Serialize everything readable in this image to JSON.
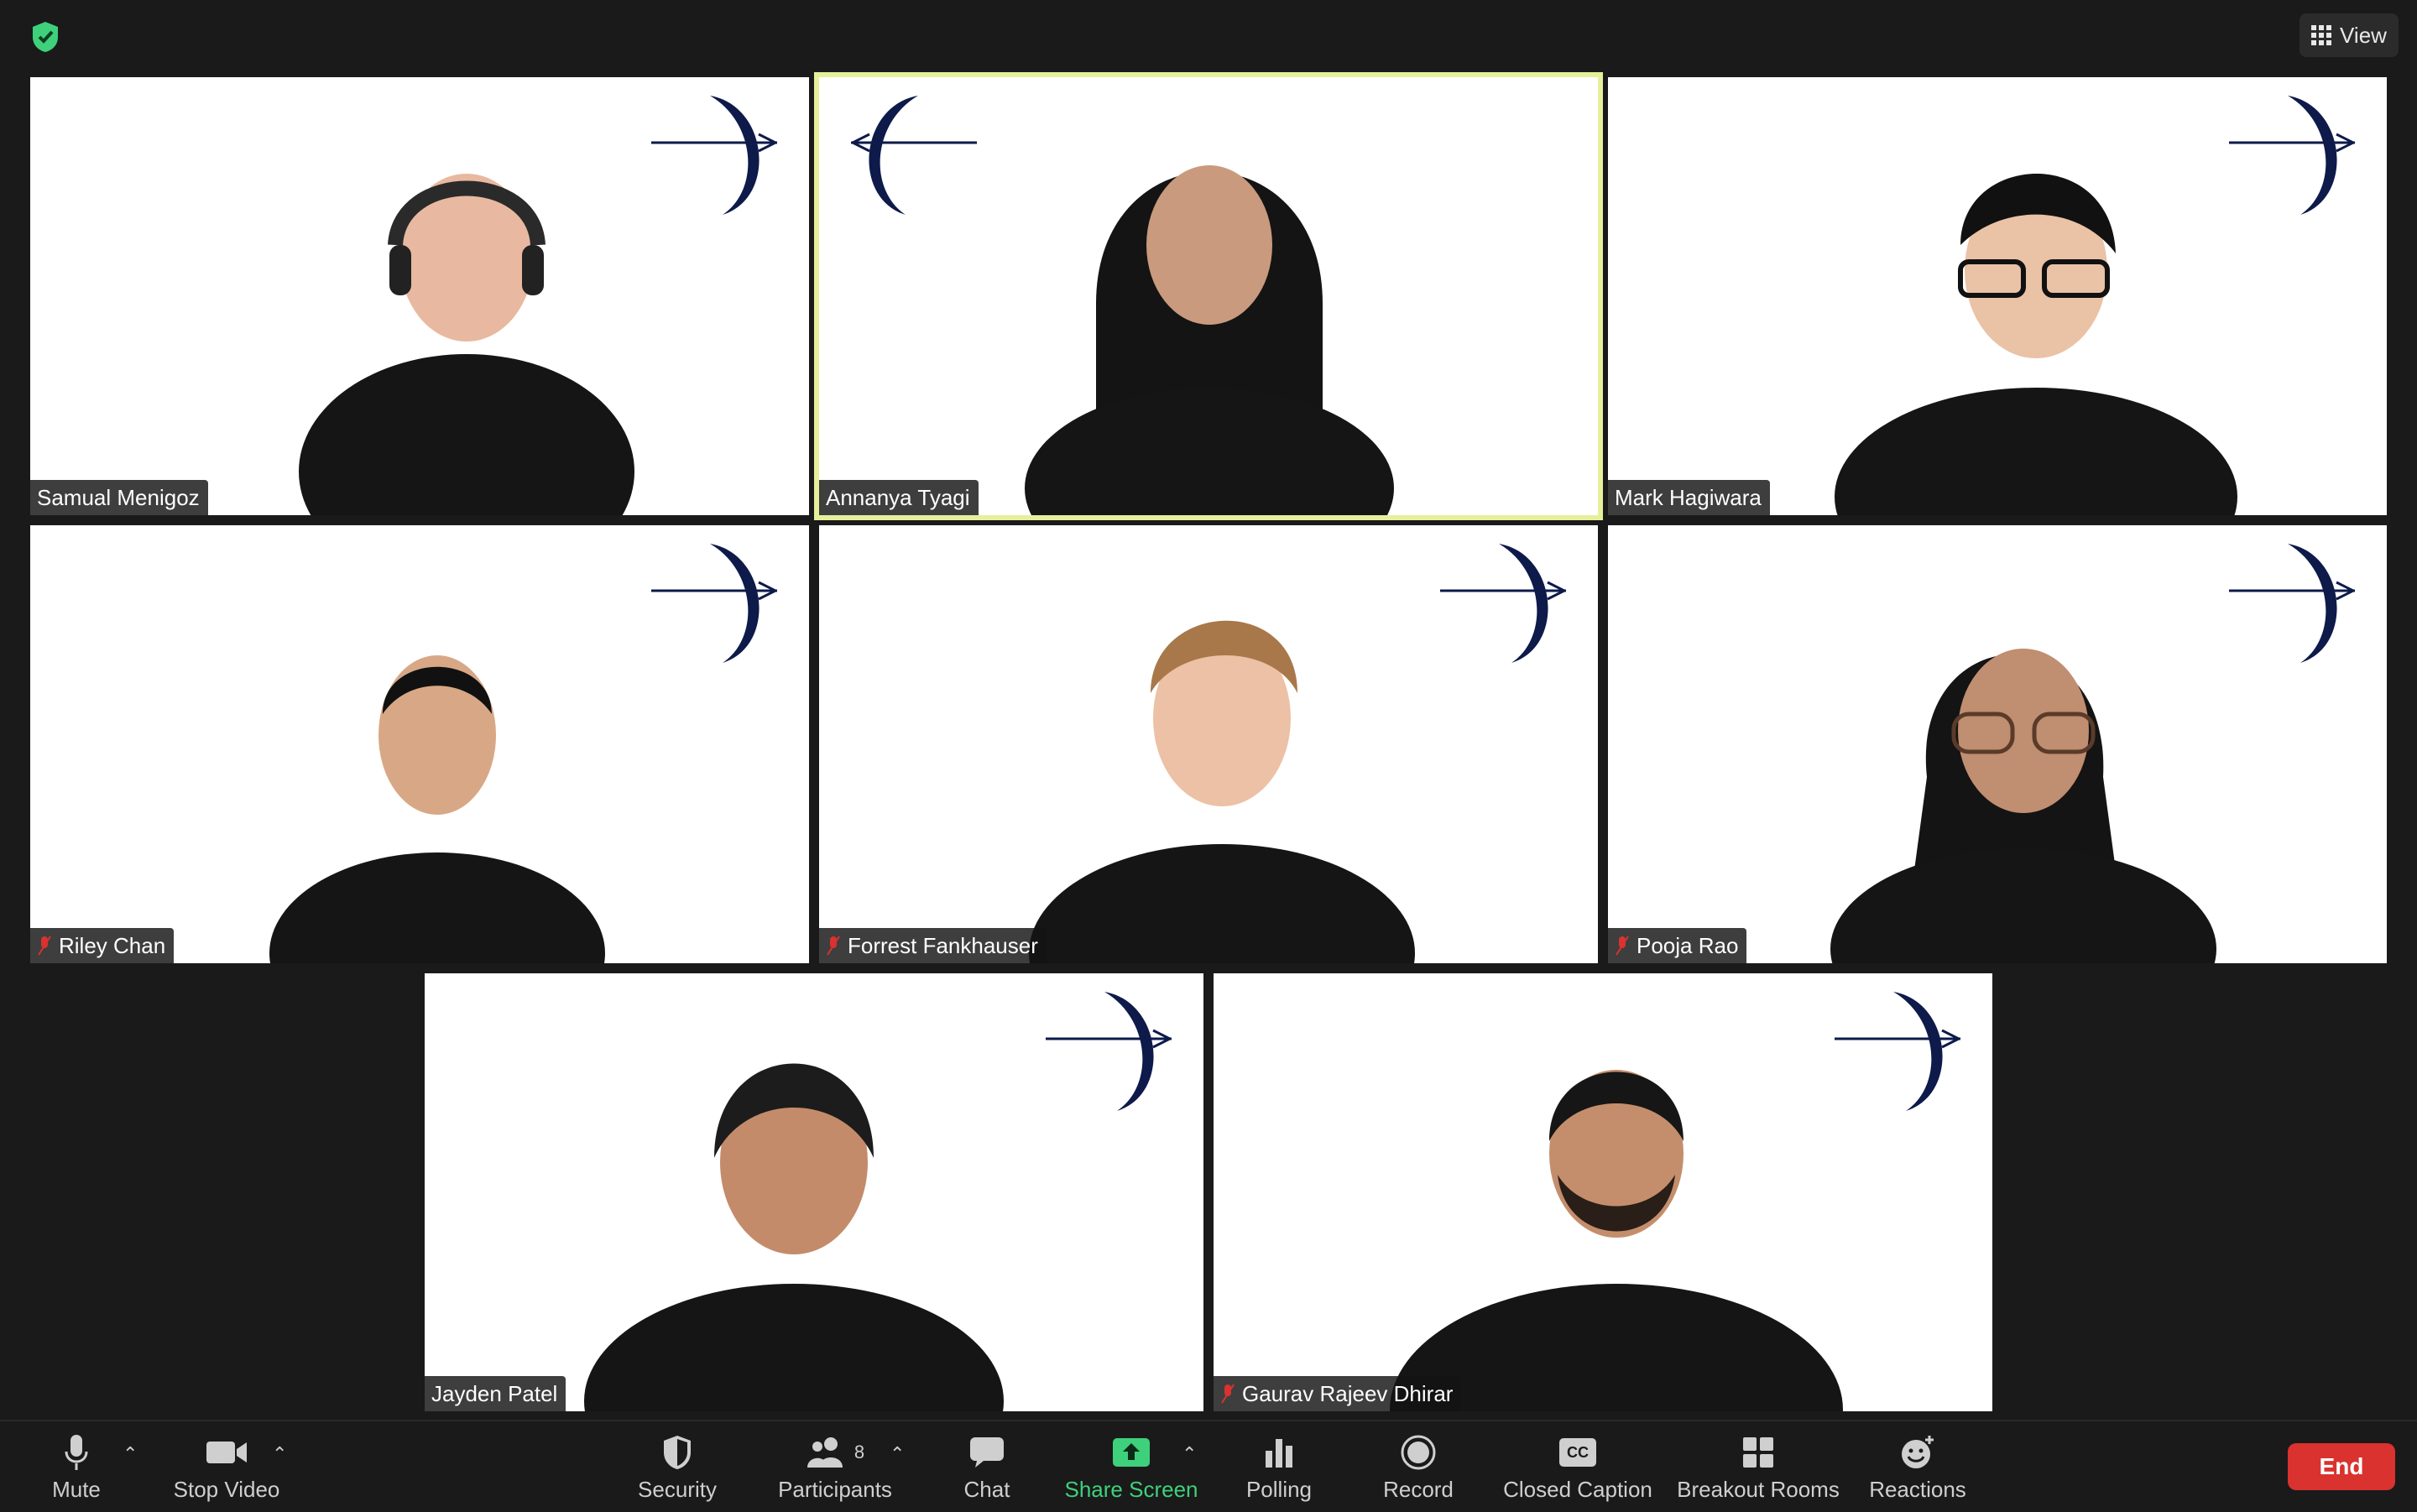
{
  "top": {
    "view_label": "View"
  },
  "participants": [
    {
      "name": "Samual Menigoz",
      "muted": false,
      "active": false
    },
    {
      "name": "Annanya Tyagi",
      "muted": false,
      "active": true
    },
    {
      "name": "Mark Hagiwara",
      "muted": false,
      "active": false
    },
    {
      "name": "Riley Chan",
      "muted": true,
      "active": false
    },
    {
      "name": "Forrest Fankhauser",
      "muted": true,
      "active": false
    },
    {
      "name": "Pooja Rao",
      "muted": true,
      "active": false
    },
    {
      "name": "Jayden Patel",
      "muted": false,
      "active": false
    },
    {
      "name": "Gaurav Rajeev Dhirar",
      "muted": true,
      "active": false
    }
  ],
  "toolbar": {
    "mute": "Mute",
    "stop_video": "Stop Video",
    "security": "Security",
    "participants": "Participants",
    "participants_count": "8",
    "chat": "Chat",
    "share_screen": "Share Screen",
    "polling": "Polling",
    "record": "Record",
    "closed_caption": "Closed Caption",
    "cc_badge": "CC",
    "breakout_rooms": "Breakout Rooms",
    "reactions": "Reactions",
    "end": "End"
  },
  "colors": {
    "active_border": "#e7ef9a",
    "share_green": "#3fd07b",
    "end_red": "#d9322f",
    "shirt": "#151515",
    "logo_navy": "#0d1a4a",
    "mute_red": "#d9322f"
  }
}
